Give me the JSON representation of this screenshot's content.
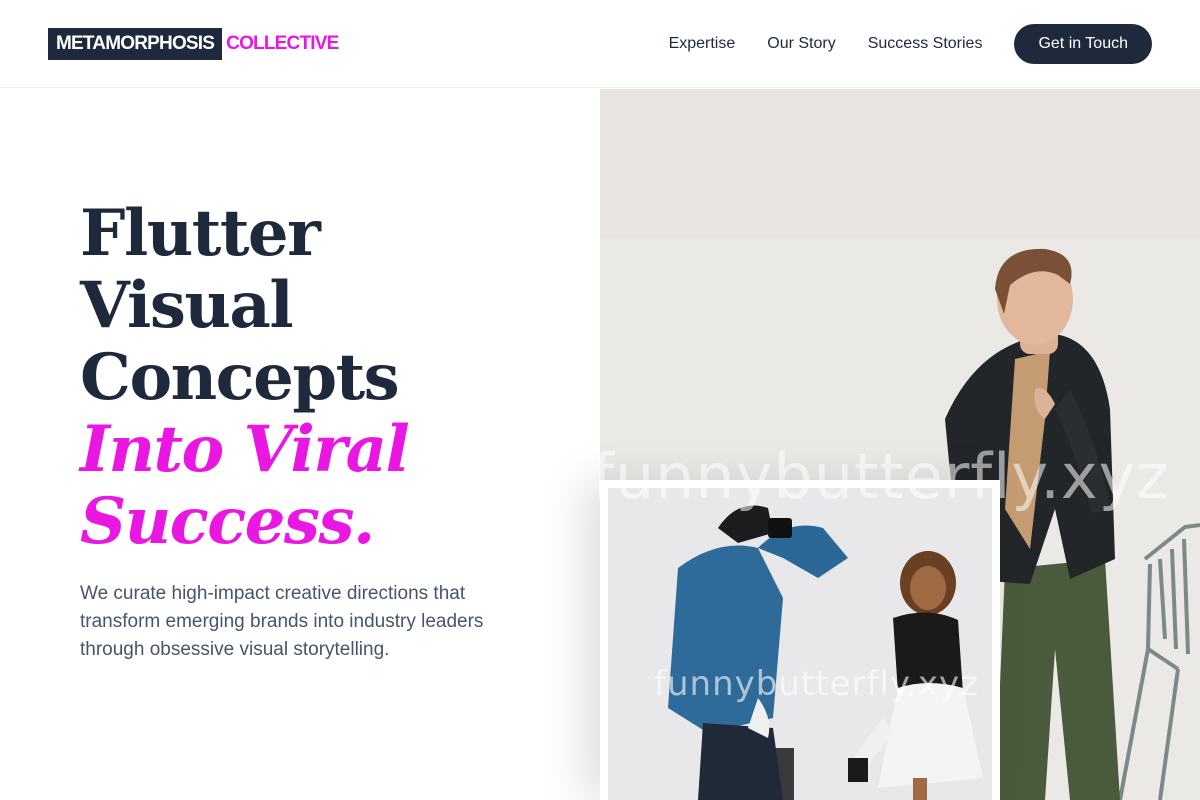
{
  "brand": {
    "name_part1": "METAMORPHOSIS",
    "name_part2": "COLLECTIVE",
    "primary": "#1e293b",
    "accent": "#ea17e2"
  },
  "nav": {
    "items": [
      {
        "label": "Expertise"
      },
      {
        "label": "Our Story"
      },
      {
        "label": "Success Stories"
      }
    ],
    "cta_label": "Get in Touch"
  },
  "hero": {
    "headline_lines": [
      "Flutter",
      "Visual",
      "Concepts"
    ],
    "headline_accent_lines": [
      "Into Viral",
      "Success."
    ],
    "subtitle": "We curate high-impact creative directions that transform emerging brands into industry leaders through obsessive visual storytelling."
  },
  "images": {
    "main_watermark": "funnybutterfly.xyz",
    "small_watermark": "funnybutterfly.xyz"
  }
}
